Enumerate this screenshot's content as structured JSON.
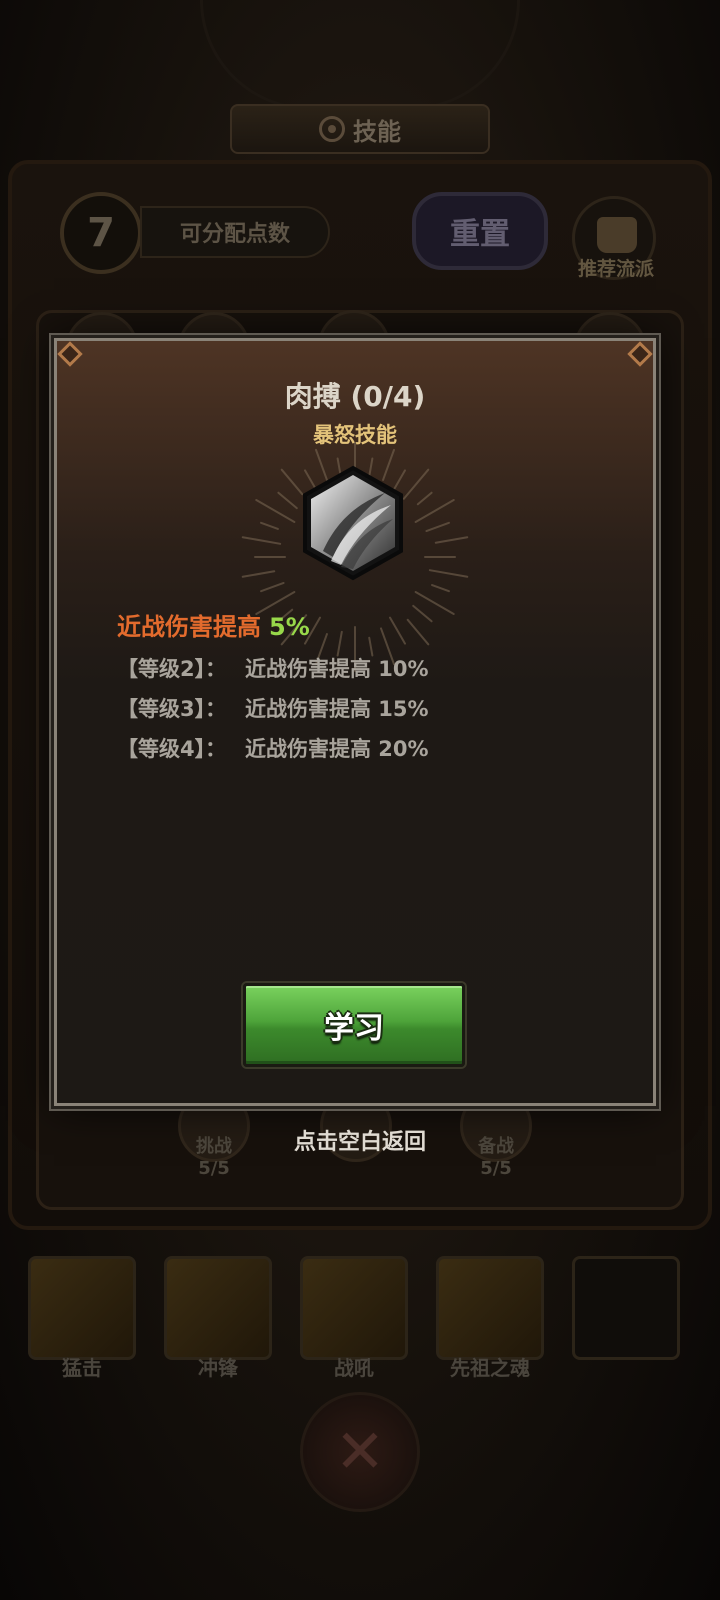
{
  "header": {
    "title": "技能",
    "title_icon": "film-reel-icon"
  },
  "top_panel": {
    "points_value": "7",
    "points_label": "可分配点数",
    "reset_label": "重置",
    "recommend_label": "推荐流派"
  },
  "background_nodes": [
    {
      "label": "挑战",
      "count": "5/5"
    },
    {
      "label": "备战",
      "count": "5/5"
    }
  ],
  "skill_bar": [
    {
      "name": "猛击",
      "icon": "slash-icon"
    },
    {
      "name": "冲锋",
      "icon": "charge-icon"
    },
    {
      "name": "战吼",
      "icon": "roar-icon"
    },
    {
      "name": "先祖之魂",
      "icon": "ancestor-icon"
    }
  ],
  "modal": {
    "title": "肉搏 (0/4)",
    "skill_type": "暴怒技能",
    "skill_icon": "claw-slash-icon",
    "current_effect_text": "近战伤害提高",
    "current_effect_value": "5%",
    "levels": [
      {
        "level": "【等级2】：",
        "effect": "近战伤害提高 10%"
      },
      {
        "level": "【等级3】：",
        "effect": "近战伤害提高 15%"
      },
      {
        "level": "【等级4】：",
        "effect": "近战伤害提高 20%"
      }
    ],
    "learn_button": "学习"
  },
  "dismiss_hint": "点击空白返回",
  "colors": {
    "accent_orange": "#e36b2d",
    "accent_green": "#98d84a",
    "skill_type_gold": "#e3c37a",
    "button_green": "#4ea43a"
  }
}
